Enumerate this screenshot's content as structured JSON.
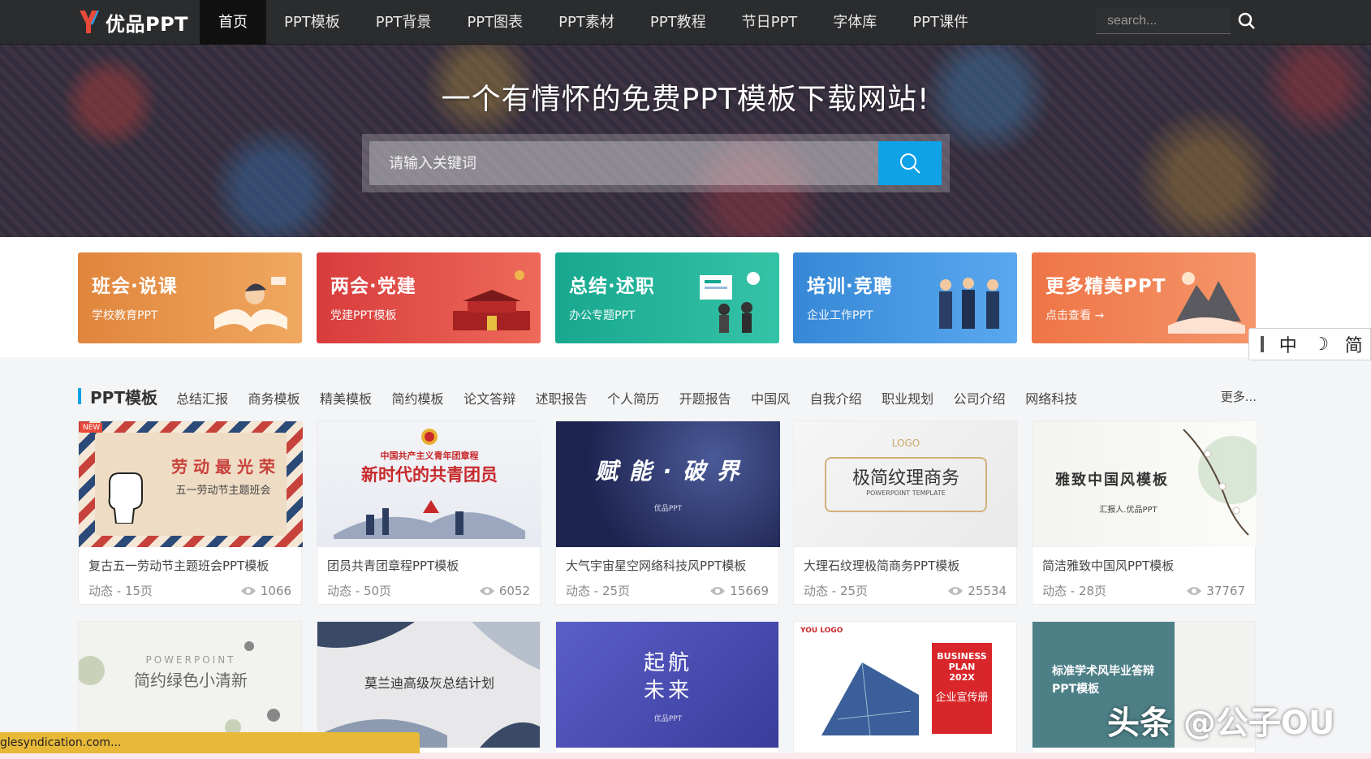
{
  "header": {
    "logo_text": "优品PPT",
    "nav": [
      "首页",
      "PPT模板",
      "PPT背景",
      "PPT图表",
      "PPT素材",
      "PPT教程",
      "节日PPT",
      "字体库",
      "PPT课件"
    ],
    "search_placeholder": "search..."
  },
  "hero": {
    "title": "一个有情怀的免费PPT模板下载网站!",
    "search_placeholder": "请输入关键词",
    "accent": "#0fa2e6"
  },
  "categories": [
    {
      "title": "班会·说课",
      "subtitle": "学校教育PPT",
      "color": "#e58a3e"
    },
    {
      "title": "两会·党建",
      "subtitle": "党建PPT模板",
      "color": "#e24a4a"
    },
    {
      "title": "总结·述职",
      "subtitle": "办公专题PPT",
      "color": "#1fb39a"
    },
    {
      "title": "培训·竞聘",
      "subtitle": "企业工作PPT",
      "color": "#3e8ed9"
    },
    {
      "title": "更多精美PPT",
      "subtitle": "点击查看 →",
      "color": "#f07a4c"
    }
  ],
  "ime": {
    "items": [
      "中",
      "☽",
      "简"
    ]
  },
  "section": {
    "title": "PPT模板",
    "tags": [
      "总结汇报",
      "商务模板",
      "精美模板",
      "简约模板",
      "论文答辩",
      "述职报告",
      "个人简历",
      "开题报告",
      "中国风",
      "自我介绍",
      "职业规划",
      "公司介绍",
      "网络科技"
    ],
    "more": "更多..."
  },
  "cards": [
    {
      "title": "复古五一劳动节主题班会PPT模板",
      "meta": "动态 - 15页",
      "views": "1066",
      "badge": "NEW",
      "thumb_title": "劳 动 最 光 荣",
      "thumb_sub": "五一劳动节主题班会"
    },
    {
      "title": "团员共青团章程PPT模板",
      "meta": "动态 - 50页",
      "views": "6052",
      "thumb_title": "新时代的共青团员",
      "thumb_sub": "中国共产主义青年团章程"
    },
    {
      "title": "大气宇宙星空网络科技风PPT模板",
      "meta": "动态 - 25页",
      "views": "15669",
      "thumb_title": "赋 能 · 破 界",
      "thumb_sub": "优品PPT"
    },
    {
      "title": "大理石纹理极简商务PPT模板",
      "meta": "动态 - 25页",
      "views": "25534",
      "thumb_title": "极简纹理商务",
      "thumb_sub": "POWERPOINT TEMPLATE",
      "thumb_logo": "LOGO"
    },
    {
      "title": "简洁雅致中国风PPT模板",
      "meta": "动态 - 28页",
      "views": "37767",
      "thumb_title": "雅致中国风模板",
      "thumb_sub": "汇报人.优品PPT"
    }
  ],
  "cards_row2": [
    {
      "thumb_title": "简约绿色小清新",
      "thumb_sub": "POWERPOINT"
    },
    {
      "thumb_title": "莫兰迪高级灰总结计划",
      "thumb_sub": ""
    },
    {
      "thumb_title": "起航",
      "thumb_title2": "未来",
      "thumb_sub": "优品PPT"
    },
    {
      "thumb_title": "BUSINESS PLAN 202X",
      "thumb_title2": "企业宣传册",
      "thumb_logo": "YOU LOGO"
    },
    {
      "thumb_title": "标准学术风毕业答辩",
      "thumb_title2": "PPT模板"
    }
  ],
  "status": "glesyndication.com...",
  "watermark": "头条 @公子OU"
}
